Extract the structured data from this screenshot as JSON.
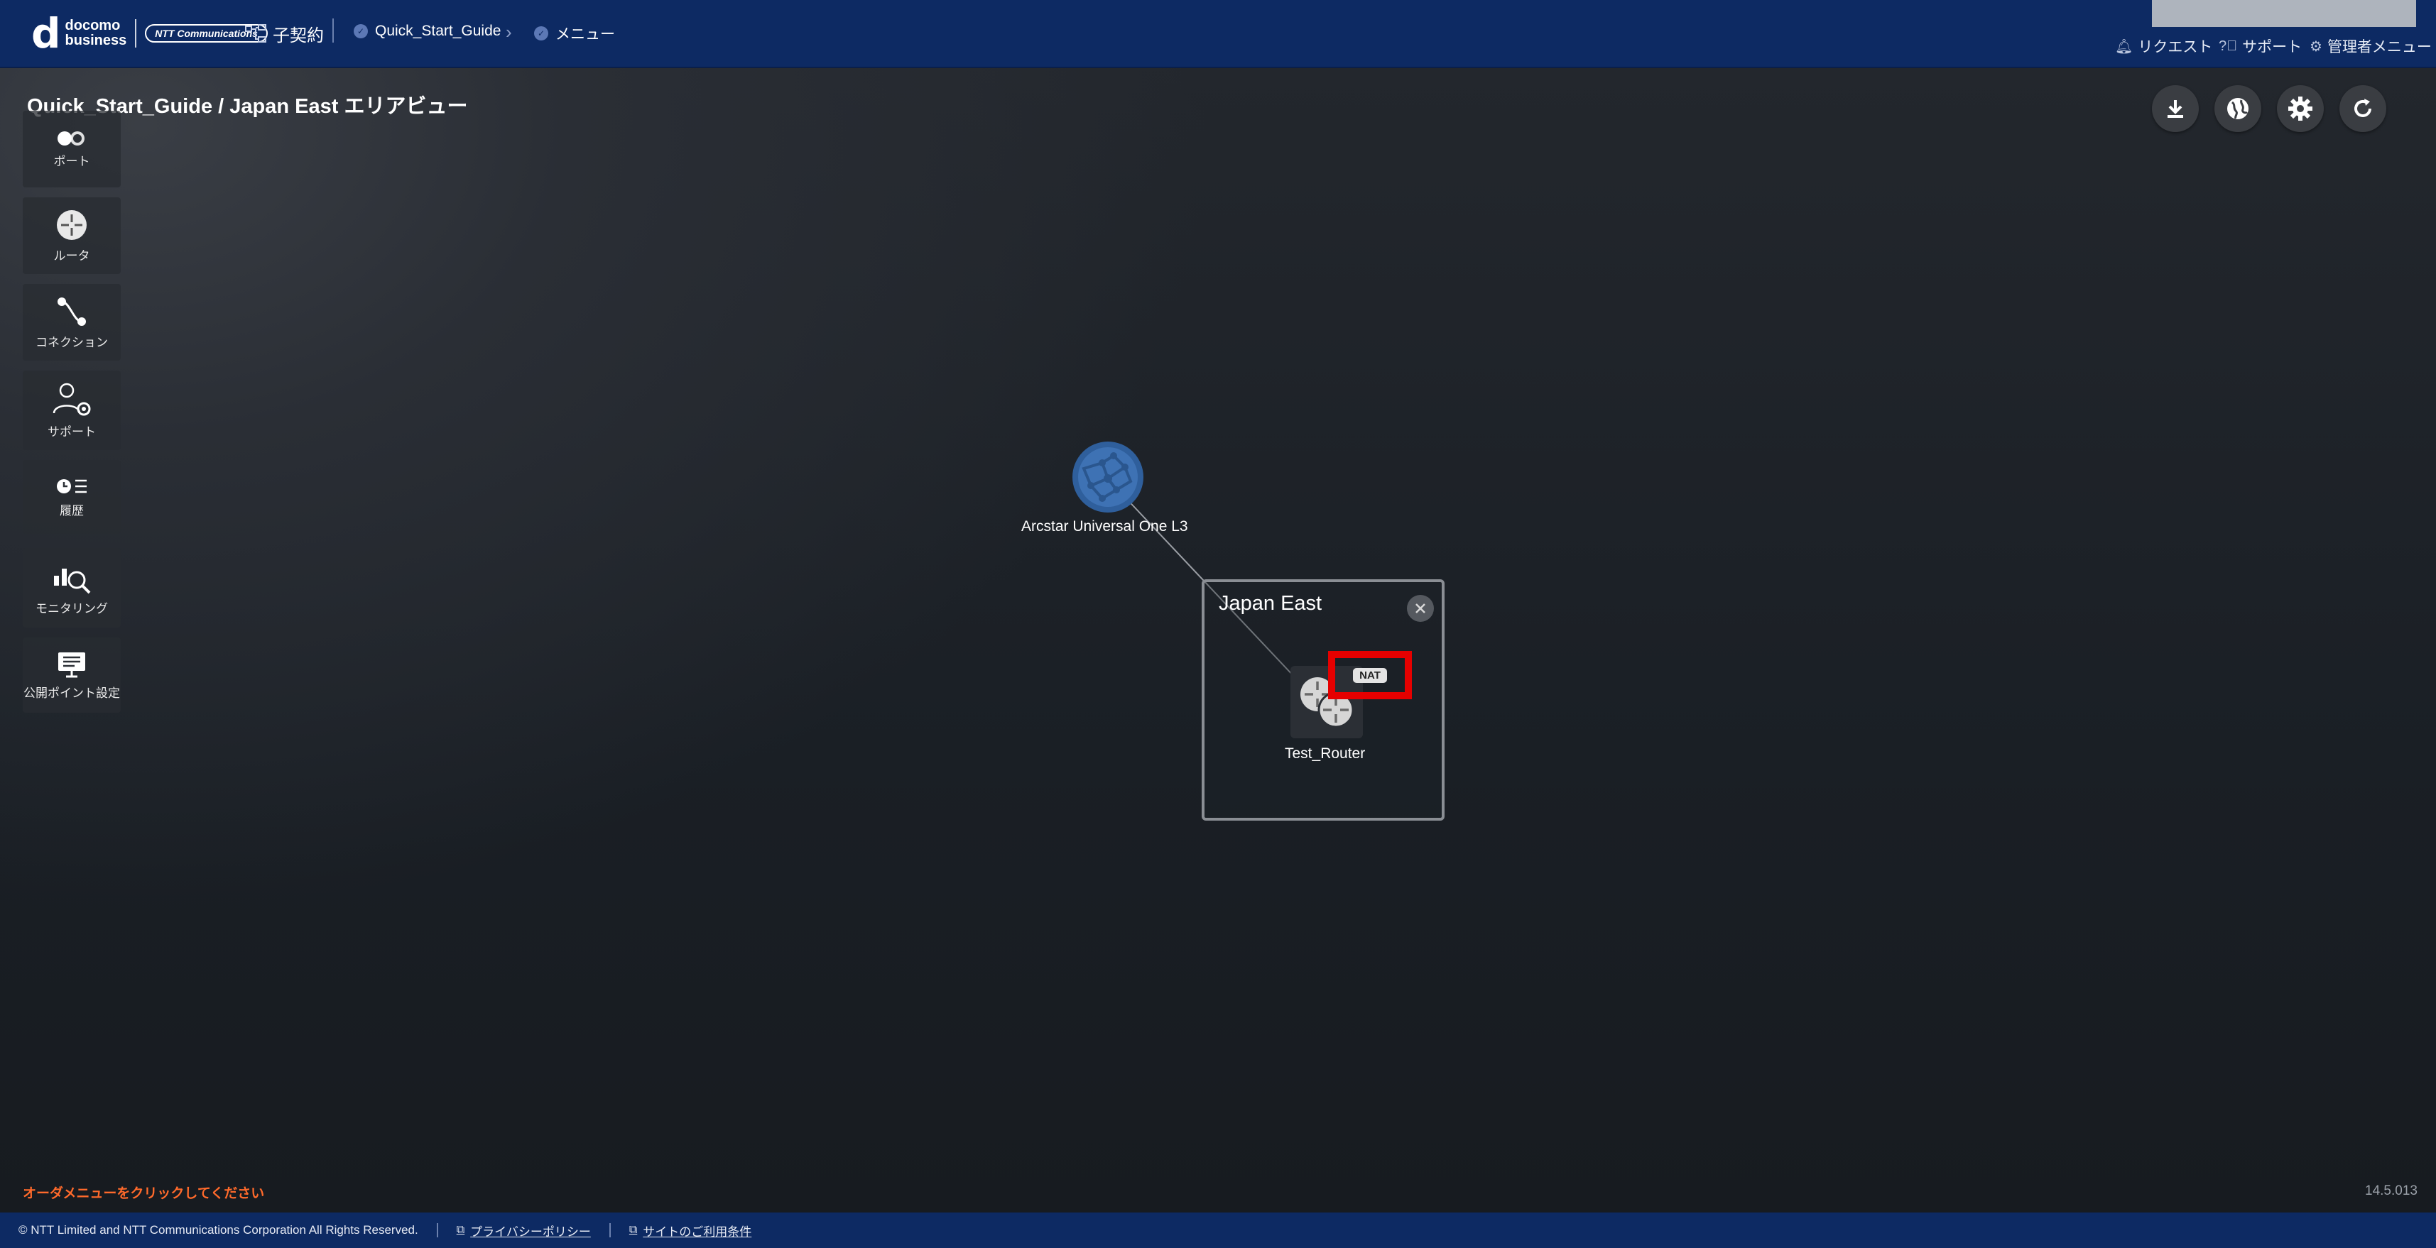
{
  "header": {
    "brand_letter": "d",
    "brand_line1": "docomo",
    "brand_line2": "business",
    "brand_ntt": "NTT Communications",
    "child_contract": "子契約",
    "breadcrumb": [
      "Quick_Start_Guide",
      "メニュー"
    ],
    "links": [
      "リクエスト",
      "サポート",
      "管理者メニュー"
    ]
  },
  "page_title": "Quick_Start_Guide / Japan East エリアビュー",
  "sidebar": [
    {
      "label": "ポート",
      "icon": "port-icon"
    },
    {
      "label": "ルータ",
      "icon": "router-icon"
    },
    {
      "label": "コネクション",
      "icon": "connection-icon"
    },
    {
      "label": "サポート",
      "icon": "support-user-icon"
    },
    {
      "label": "履歴",
      "icon": "history-icon"
    },
    {
      "label": "モニタリング",
      "icon": "monitoring-icon"
    },
    {
      "label": "公開ポイント設定",
      "icon": "public-point-icon"
    }
  ],
  "toolbar": [
    "download-icon",
    "globe-icon",
    "settings-gear-icon",
    "refresh-icon"
  ],
  "topology": {
    "network_node": "Arcstar Universal One L3",
    "area": {
      "title": "Japan East"
    },
    "router": {
      "name": "Test_Router",
      "badge": "NAT"
    }
  },
  "hint": "オーダメニューをクリックしてください",
  "version": "14.5.013",
  "footer": {
    "copyright": "© NTT Limited and NTT Communications Corporation All Rights Reserved.",
    "links": [
      "プライバシーポリシー",
      "サイトのご利用条件"
    ]
  },
  "colors": {
    "header": "#0d2a63",
    "highlight": "#e60000",
    "hint": "#ff6a2b"
  }
}
